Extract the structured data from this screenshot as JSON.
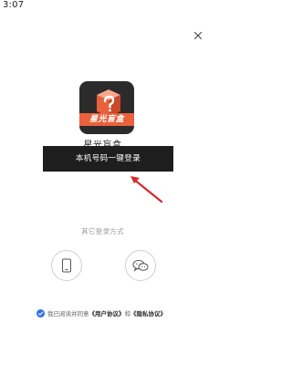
{
  "status_bar": {
    "time": "3:07"
  },
  "app": {
    "logo_text": "星光盲盒",
    "name": "星光盲盒"
  },
  "login": {
    "one_click_label": "本机号码一键登录"
  },
  "other_login": {
    "label": "其它登录方式",
    "options": [
      {
        "icon": "phone-icon"
      },
      {
        "icon": "wechat-icon"
      }
    ]
  },
  "agreement": {
    "prefix": "我已阅读并同意",
    "user_agreement": "《用户协议》",
    "and": "和",
    "privacy_policy": "《隐私协议》"
  },
  "colors": {
    "button_bg": "#1e1e1e",
    "logo_band": "#e9613d",
    "checkbox": "#2f6fe4",
    "arrow": "#d9292a"
  }
}
